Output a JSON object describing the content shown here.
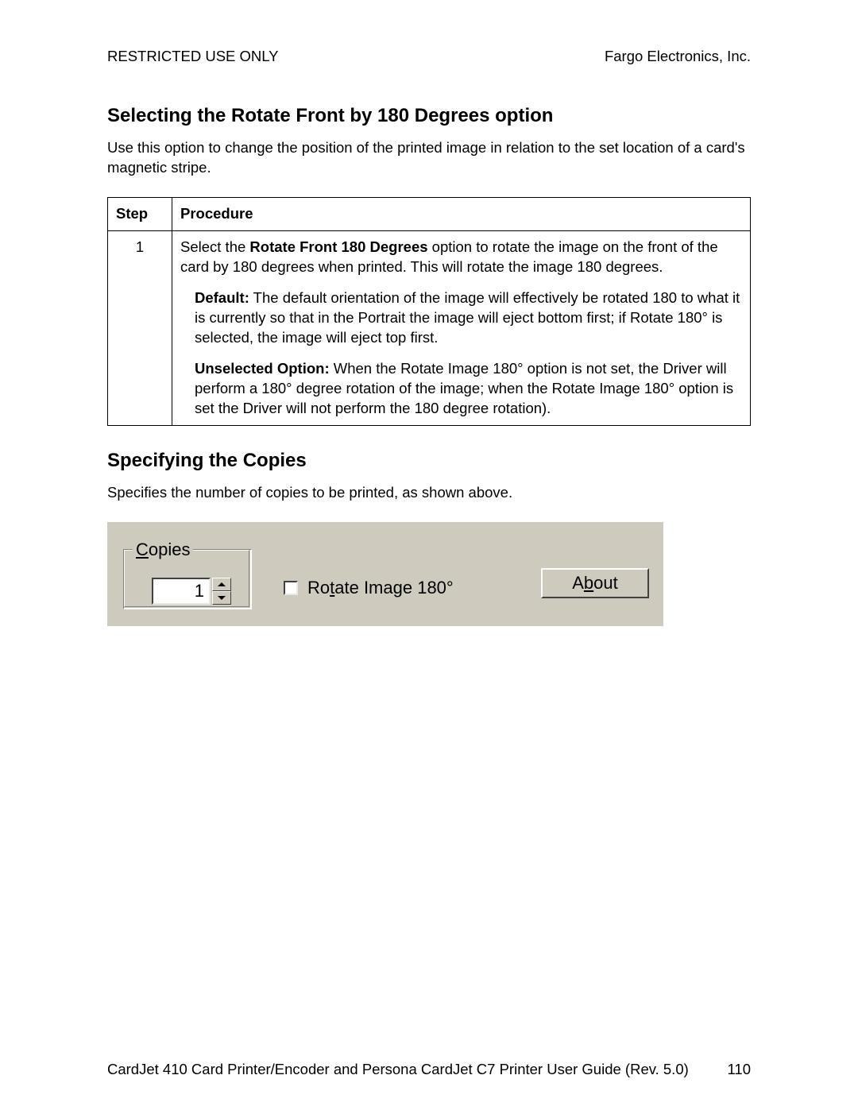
{
  "header": {
    "left": "RESTRICTED USE ONLY",
    "right": "Fargo Electronics, Inc."
  },
  "section1": {
    "title": "Selecting the Rotate Front by 180 Degrees option",
    "intro": "Use this option to change the position of the printed image in relation to the set location of a card's magnetic stripe."
  },
  "table": {
    "headers": {
      "step": "Step",
      "procedure": "Procedure"
    },
    "row1": {
      "step": "1",
      "p1_pre": "Select the ",
      "p1_bold": "Rotate Front 180 Degrees",
      "p1_post": " option to rotate the image on the front of the card by 180 degrees when printed. This will rotate the image 180 degrees.",
      "p2_bold": "Default:",
      "p2_text": "  The default orientation of the image will effectively be rotated 180 to what it is currently so that in the Portrait the image will eject bottom first; if Rotate 180° is selected, the image will eject top first.",
      "p3_bold": "Unselected Option:",
      "p3_text": "  When the Rotate Image 180° option is not set, the Driver will perform a 180° degree rotation of the image; when the Rotate Image 180° option is set the Driver will not perform the 180 degree rotation)."
    }
  },
  "section2": {
    "title": "Specifying the Copies",
    "intro": "Specifies the number of copies to be printed, as shown above."
  },
  "ui": {
    "copies_label_u": "C",
    "copies_label_rest": "opies",
    "copies_value": "1",
    "rotate_pre": "Ro",
    "rotate_u": "t",
    "rotate_post": "ate Image 180°",
    "about_pre": "A",
    "about_u": "b",
    "about_post": "out"
  },
  "footer": {
    "left": "CardJet 410 Card Printer/Encoder and Persona CardJet C7 Printer User Guide (Rev. 5.0)",
    "right": "110"
  }
}
